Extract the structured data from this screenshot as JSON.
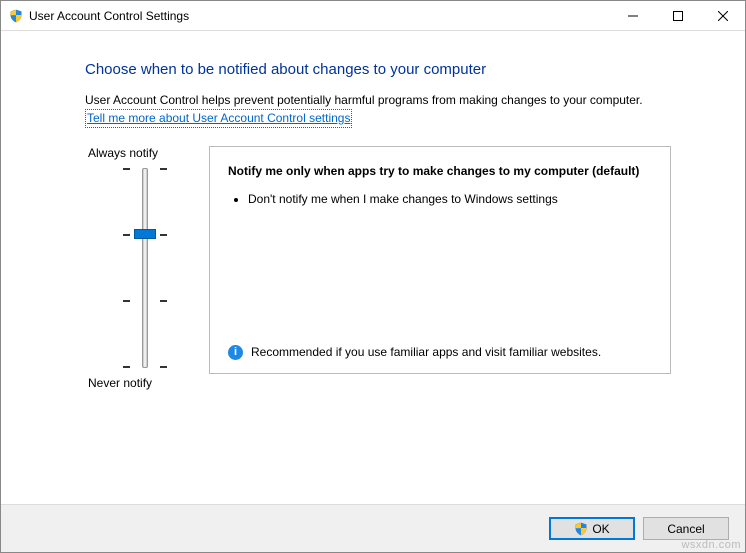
{
  "window": {
    "title": "User Account Control Settings"
  },
  "heading": "Choose when to be notified about changes to your computer",
  "description": "User Account Control helps prevent potentially harmful programs from making changes to your computer.",
  "help_link": "Tell me more about User Account Control settings",
  "slider": {
    "top_label": "Always notify",
    "bottom_label": "Never notify",
    "levels": 4,
    "selected_index": 1
  },
  "panel": {
    "heading": "Notify me only when apps try to make changes to my computer (default)",
    "bullets": [
      "Don't notify me when I make changes to Windows settings"
    ],
    "recommendation": "Recommended if you use familiar apps and visit familiar websites."
  },
  "buttons": {
    "ok": "OK",
    "cancel": "Cancel"
  },
  "watermark": "wsxdn.com"
}
